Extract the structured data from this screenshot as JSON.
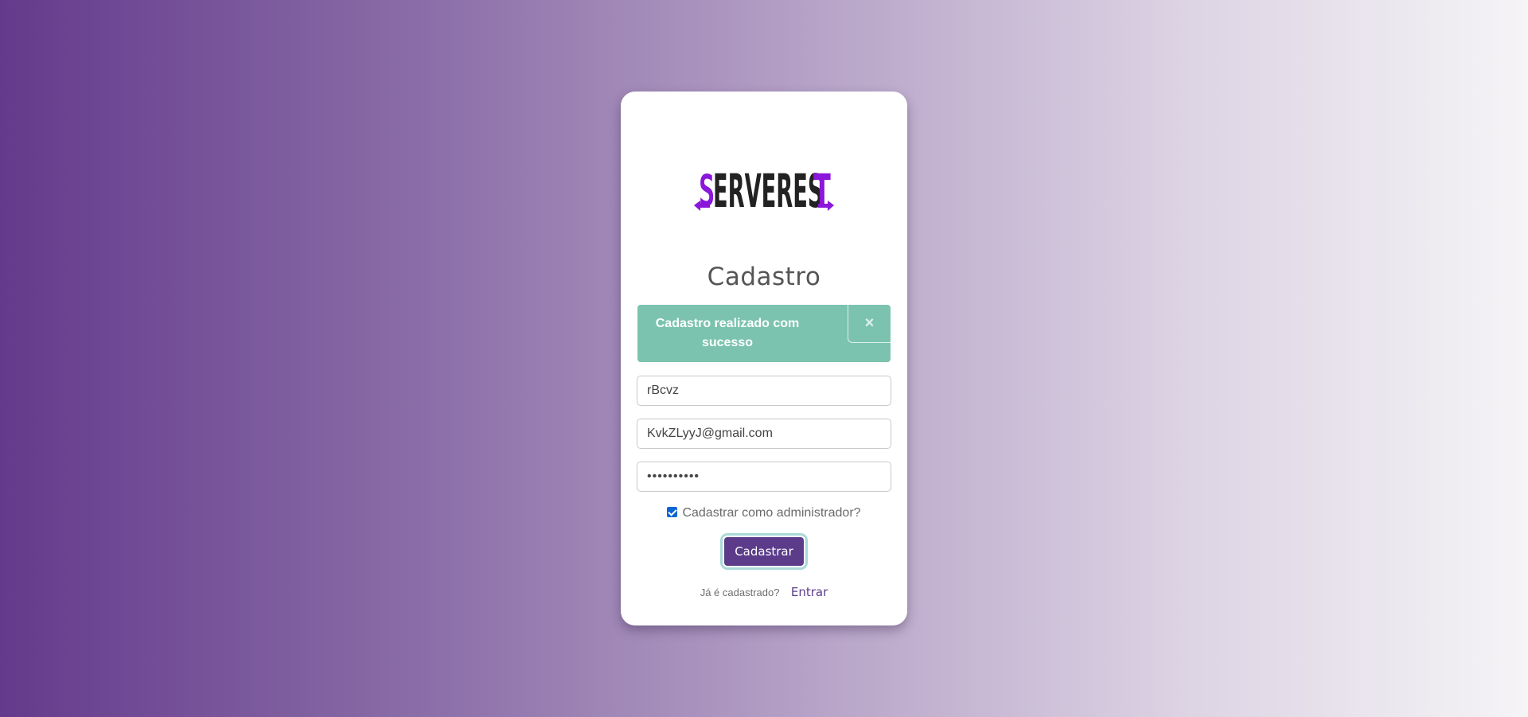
{
  "brand": {
    "logo_text": "SERVEREST",
    "logo_accent_color": "#8a17d9",
    "logo_text_color": "#222222"
  },
  "page": {
    "title": "Cadastro"
  },
  "alert": {
    "message": "Cadastro realizado com sucesso",
    "close_label": "×",
    "color": "#7bc3ae"
  },
  "form": {
    "name_value": "rBcvz",
    "email_value": "KvkZLyyJ@gmail.com",
    "password_value": "••••••••••",
    "admin_checkbox_label": "Cadastrar como administrador?",
    "admin_checked": true,
    "submit_label": "Cadastrar"
  },
  "footer": {
    "question": "Já é cadastrado?",
    "link_label": "Entrar"
  },
  "colors": {
    "primary": "#5b3b8a",
    "checkbox": "#0b66d4"
  }
}
